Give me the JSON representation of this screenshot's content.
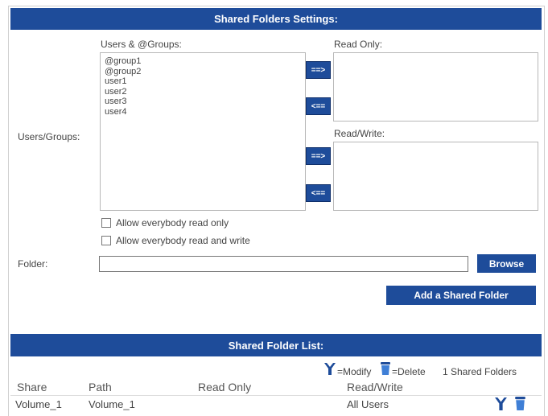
{
  "settings": {
    "title": "Shared Folders Settings:",
    "users_groups_label": "Users/Groups:",
    "users_list_header": "Users & @Groups:",
    "users_list": [
      "@group1",
      "@group2",
      "user1",
      "user2",
      "user3",
      "user4"
    ],
    "read_only_header": "Read Only:",
    "read_write_header": "Read/Write:",
    "move_right_label": "==>",
    "move_left_label": "<==",
    "allow_read_only_label": "Allow everybody read only",
    "allow_read_write_label": "Allow everybody read and write",
    "folder_label": "Folder:",
    "folder_value": "",
    "browse_label": "Browse",
    "add_button_label": "Add a Shared Folder"
  },
  "list": {
    "title": "Shared Folder List:",
    "legend_modify": "=Modify",
    "legend_delete": "=Delete",
    "count_text": "1 Shared Folders",
    "columns": {
      "share": "Share",
      "path": "Path",
      "read_only": "Read Only",
      "read_write": "Read/Write"
    },
    "rows": [
      {
        "share": "Volume_1",
        "path": "Volume_1",
        "read_only": "",
        "read_write": "All Users"
      }
    ]
  },
  "colors": {
    "accent": "#1e4c9a"
  },
  "icons": {
    "modify": "wrench-icon",
    "delete": "trash-icon"
  }
}
